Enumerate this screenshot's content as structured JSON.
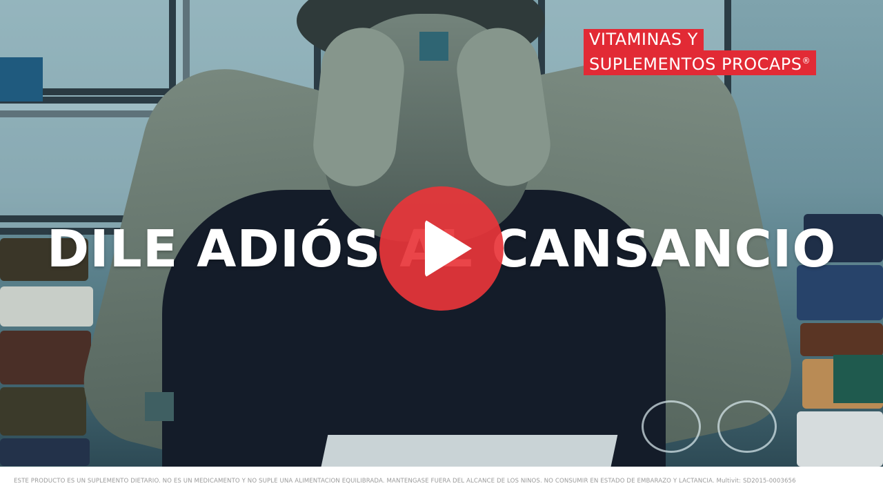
{
  "brand": {
    "line1": "VITAMINAS Y",
    "line2": "SUPLEMENTOS PROCAPS",
    "registered": "®",
    "color": "#e22a35"
  },
  "headline": "DILE ADIÓS AL CANSANCIO",
  "video": {
    "play_icon": "play-icon",
    "play_color": "#e8353a"
  },
  "disclaimer": "ESTE PRODUCTO ES UN SUPLEMENTO DIETARIO. NO ES UN MEDICAMENTO Y NO SUPLE UNA ALIMENTACIÓN EQUILIBRADA. MANTÉNGASE FUERA DEL ALCANCE DE LOS NIÑOS. NO CONSUMIR EN ESTADO DE EMBARAZO Y LACTANCIA. Multivit: SD2015-0003656"
}
